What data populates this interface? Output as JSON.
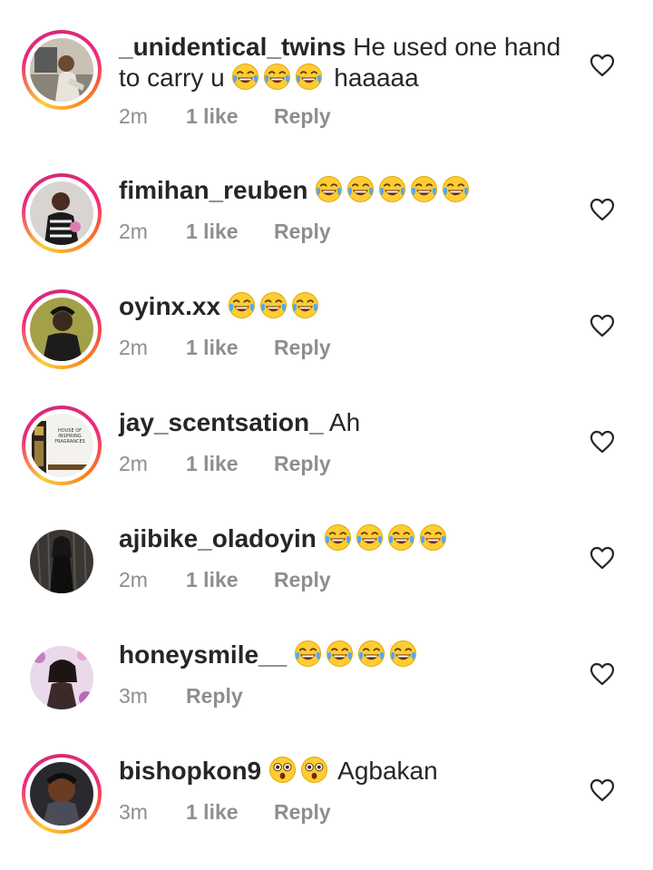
{
  "comments": [
    {
      "username": "_unidentical_twins",
      "text_before": "He used one hand to carry u",
      "emoji": "joy",
      "emoji_count": 3,
      "text_after": "haaaaa",
      "time": "2m",
      "likes": "1 like",
      "reply": "Reply"
    },
    {
      "username": "fimihan_reuben",
      "text_before": "",
      "emoji": "joy",
      "emoji_count": 5,
      "text_after": "",
      "time": "2m",
      "likes": "1 like",
      "reply": "Reply"
    },
    {
      "username": "oyinx.xx",
      "text_before": "",
      "emoji": "joy",
      "emoji_count": 3,
      "text_after": "",
      "time": "2m",
      "likes": "1 like",
      "reply": "Reply"
    },
    {
      "username": "jay_scentsation_",
      "text_before": "Ah",
      "emoji": "",
      "emoji_count": 0,
      "text_after": "",
      "time": "2m",
      "likes": "1 like",
      "reply": "Reply",
      "avatar_text": [
        "HOUSE OF",
        "INSPIRING",
        "FRAGRANCES"
      ]
    },
    {
      "username": "ajibike_oladoyin",
      "text_before": "",
      "emoji": "joy",
      "emoji_count": 4,
      "text_after": "",
      "time": "2m",
      "likes": "1 like",
      "reply": "Reply"
    },
    {
      "username": "honeysmile__",
      "text_before": "",
      "emoji": "joy",
      "emoji_count": 4,
      "text_after": "",
      "time": "3m",
      "likes": "",
      "reply": "Reply"
    },
    {
      "username": "bishopkon9",
      "text_before": "",
      "emoji": "flushed",
      "emoji_count": 2,
      "text_after": "Agbakan",
      "time": "3m",
      "likes": "1 like",
      "reply": "Reply"
    }
  ],
  "icons": {
    "like": "heart-outline-icon",
    "joy": "face-with-tears-of-joy-emoji",
    "flushed": "astonished-face-emoji"
  },
  "colors": {
    "text": "#262626",
    "secondary": "#8e8e8e",
    "ring_start": "#f9ce34",
    "ring_mid": "#ee2a7b",
    "ring_end": "#fa7e1e"
  }
}
